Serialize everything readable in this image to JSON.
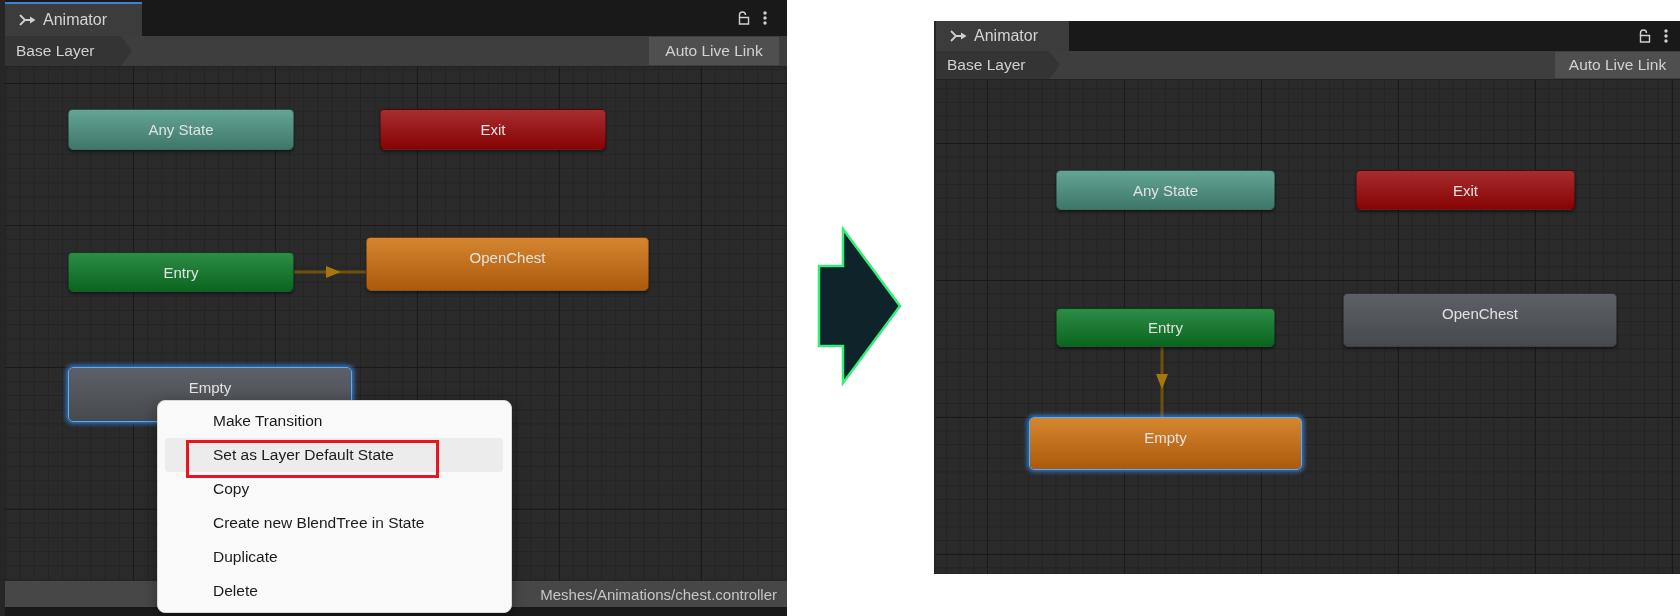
{
  "panels": [
    {
      "tab": {
        "label": "Animator",
        "focused": true
      },
      "breadcrumb": "Base Layer",
      "live_link_button": "Auto Live Link",
      "states": [
        {
          "label": "Any State",
          "kind": "any",
          "selected": false
        },
        {
          "label": "Exit",
          "kind": "exit",
          "selected": false
        },
        {
          "label": "Entry",
          "kind": "entry",
          "selected": false
        },
        {
          "label": "OpenChest",
          "kind": "default",
          "selected": false
        },
        {
          "label": "Empty",
          "kind": "normal",
          "selected": true
        }
      ],
      "context_menu": {
        "items": [
          {
            "label": "Make Transition",
            "selected": false,
            "annotated": false
          },
          {
            "label": "Set as Layer Default State",
            "selected": true,
            "annotated": true
          },
          {
            "label": "Copy",
            "selected": false,
            "annotated": false
          },
          {
            "label": "Create new BlendTree in State",
            "selected": false,
            "annotated": false
          },
          {
            "label": "Duplicate",
            "selected": false,
            "annotated": false
          },
          {
            "label": "Delete",
            "selected": false,
            "annotated": false
          }
        ]
      },
      "status_bar": {
        "path": "Meshes/Animations/chest.controller"
      }
    },
    {
      "tab": {
        "label": "Animator",
        "focused": false
      },
      "breadcrumb": "Base Layer",
      "live_link_button": "Auto Live Link",
      "states": [
        {
          "label": "Any State",
          "kind": "any",
          "selected": false
        },
        {
          "label": "Exit",
          "kind": "exit",
          "selected": false
        },
        {
          "label": "Entry",
          "kind": "entry",
          "selected": false
        },
        {
          "label": "OpenChest",
          "kind": "normal",
          "selected": false
        },
        {
          "label": "Empty",
          "kind": "default",
          "selected": true
        }
      ]
    }
  ]
}
